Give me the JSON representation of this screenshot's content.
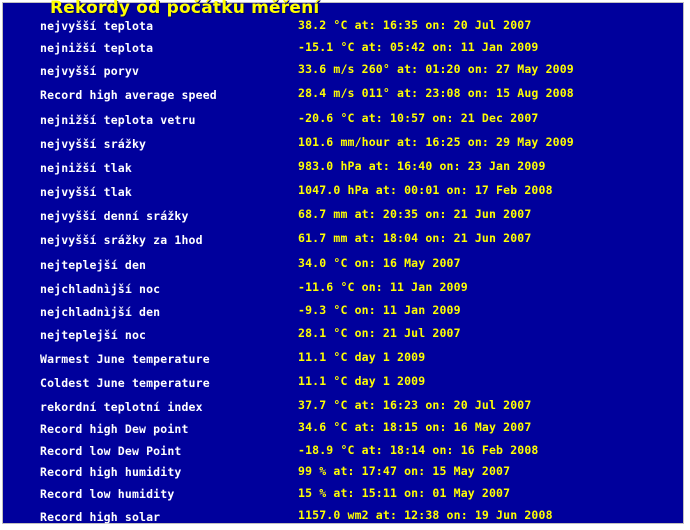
{
  "title": "Rekordy od počátku měření",
  "rows": [
    {
      "label": "nejvyšší teplota",
      "value": "38.2 °C   at: 16:35 on: 20 Jul 2007"
    },
    {
      "label": "nejnižší teplota",
      "value": "-15.1 °C   at: 05:42 on: 11 Jan 2009"
    },
    {
      "label": "nejvyšší poryv",
      "value": "33.6 m/s 260° at: 01:20 on: 27 May 2009"
    },
    {
      "label": "Record high average speed",
      "value": "28.4 m/s 011° at:  23:08 on: 15 Aug 2008"
    },
    {
      "label": "nejnižší teplota vetru",
      "value": "-20.6 °C  at: 10:57 on: 21 Dec 2007"
    },
    {
      "label": "nejvyšší srážky",
      "value": "101.6 mm/hour   at: 16:25 on: 29 May 2009"
    },
    {
      "label": "nejnižší tlak",
      "value": "983.0 hPa  at: 16:40 on: 23 Jan 2009"
    },
    {
      "label": "nejvyšší tlak",
      "value": "1047.0 hPa  at: 00:01 on: 17 Feb 2008"
    },
    {
      "label": "nejvyšší denní srážky",
      "value": "68.7 mm   at: 20:35 on: 21 Jun 2007"
    },
    {
      "label": "nejvyšší srážky za 1hod",
      "value": "61.7 mm  at: 18:04 on: 21 Jun 2007"
    },
    {
      "label": "nejteplejší den",
      "value": "34.0 °C   on: 16 May 2007"
    },
    {
      "label": "nejchladnìjší noc",
      "value": "-11.6 °C   on: 11 Jan 2009"
    },
    {
      "label": "nejchladnìjší den",
      "value": "-9.3 °C   on: 11 Jan 2009"
    },
    {
      "label": "nejteplejší noc",
      "value": "28.1 °C   on: 21 Jul 2007"
    },
    {
      "label": "Warmest June temperature",
      "value": "11.1 °C day 1 2009"
    },
    {
      "label": "Coldest June temperature",
      "value": "11.1 °C day 1 2009"
    },
    {
      "label": "rekordní teplotní index",
      "value": "37.7 °C   at: 16:23 on: 20 Jul 2007"
    },
    {
      "label": "Record high Dew point",
      "value": "34.6 °C   at: 18:15 on: 16 May 2007"
    },
    {
      "label": "Record low Dew Point",
      "value": "-18.9 °C   at: 18:14 on: 16 Feb 2008"
    },
    {
      "label": "Record high humidity",
      "value": "99 %   at: 17:47 on: 15 May 2007"
    },
    {
      "label": "Record low humidity",
      "value": "15 %   at: 15:11 on: 01 May 2007"
    },
    {
      "label": "Record high solar",
      "value": "1157.0 wm2  at: 12:38 on: 19 Jun 2008"
    }
  ],
  "colors": {
    "background": "#00009c",
    "label": "#ffffff",
    "value": "#ffff00"
  }
}
